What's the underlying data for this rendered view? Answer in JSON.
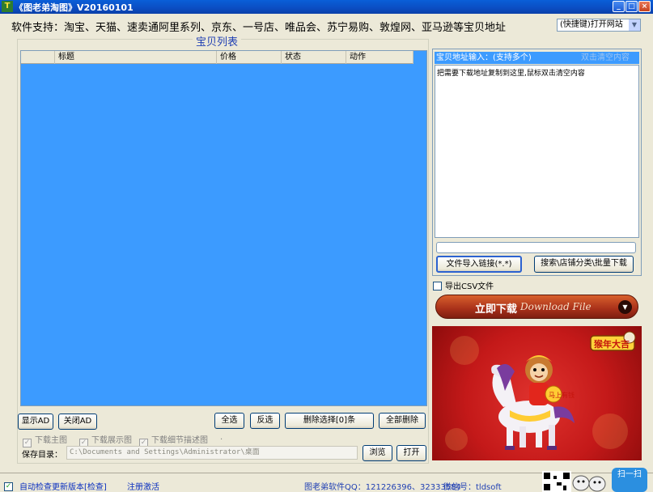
{
  "window": {
    "title": "《图老弟淘图》V20160101",
    "icon": "app-icon"
  },
  "header": {
    "support_text": "软件支持：淘宝、天猫、速卖通阿里系列、京东、一号店、唯品会、苏宁易购、敦煌网、亚马逊等宝贝地址",
    "quick_open": "(快捷键)打开网站"
  },
  "list": {
    "group_title": "宝贝列表",
    "columns": [
      "标题",
      "价格",
      "状态",
      "动作"
    ]
  },
  "toolbar": {
    "show_ad": "显示AD",
    "close_ad": "关闭AD",
    "select_all": "全选",
    "invert": "反选",
    "delete_selected": "删除选择[0]条",
    "delete_all": "全部删除"
  },
  "options": {
    "main_image": "下载主图",
    "display_image": "下载展示图",
    "detail_image": "下载细节描述图",
    "dot": "."
  },
  "save": {
    "label": "保存目录：",
    "path": "C:\\Documents and Settings\\Administrator\\桌面",
    "browse": "浏览",
    "open": "打开"
  },
  "url_panel": {
    "title": "宝贝地址输入：(支持多个)",
    "clear_hint": "双击清空内容",
    "content": "把需要下载地址复制到这里,鼠标双击清空内容"
  },
  "import": {
    "file_button": "文件导入链接(*.*)",
    "search_button": "搜索\\店铺分类\\批量下载"
  },
  "export": {
    "csv_label": "导出CSV文件"
  },
  "download": {
    "label_cn": "立即下载",
    "label_en": "Download File"
  },
  "banner": {
    "badge_text": "猴年大吉",
    "scroll_text": "马上有钱"
  },
  "status": {
    "auto_check": "自动检查更新版本[检查]",
    "register": "注册激活",
    "qq": "图老弟软件QQ：121226396、32333584",
    "wechat": "微信号：tldsoft",
    "scan": "扫一扫"
  },
  "colors": {
    "list_bg": "#3c9bff",
    "title_bar": "#0b4dc2",
    "download_button": "#b23a1e",
    "banner_bg": "#c41919"
  }
}
